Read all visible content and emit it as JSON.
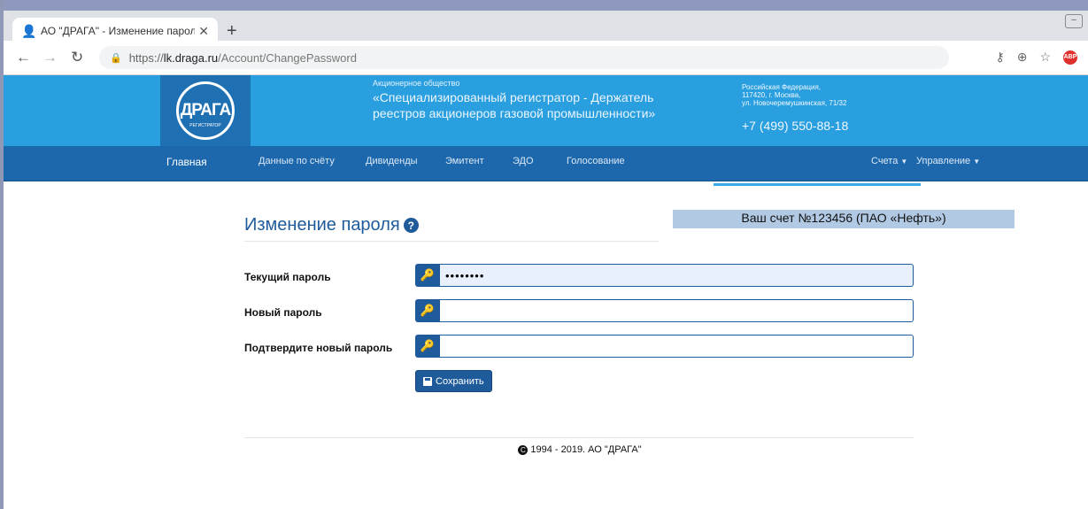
{
  "browser": {
    "tab_title": "АО \"ДРАГА\" - Изменение парол",
    "tab_close": "✕",
    "new_tab": "+",
    "url_scheme": "https://",
    "url_host": "lk.draga.ru",
    "url_path": "/Account/ChangePassword"
  },
  "header": {
    "logo_letters": "ДРАГА",
    "logo_sub": "РЕГИСТРАТОР",
    "company_small": "Акционерное общество",
    "company_name": "«Специализированный регистратор - Держатель реестров акционеров газовой промышленности»",
    "address_lines": [
      "Российская Федерация,",
      "117420, г. Москва,",
      "ул. Новочеремушкинская, 71/32"
    ],
    "phone": "+7 (499) 550-88-18"
  },
  "nav": {
    "items": [
      "Главная",
      "Данные по счёту",
      "Дивиденды",
      "Эмитент",
      "ЭДО",
      "Голосование"
    ],
    "right_items": [
      "Счета",
      "Управление"
    ]
  },
  "account_banner": "Ваш счет №123456 (ПАО «Нефть»)",
  "page_title": "Изменение пароля",
  "form": {
    "current_label": "Текущий пароль",
    "current_value": "••••••••",
    "new_label": "Новый пароль",
    "new_value": "",
    "confirm_label": "Подтвердите новый пароль",
    "confirm_value": "",
    "save_label": "Сохранить"
  },
  "footer": {
    "text": "1994 - 2019. АО \"ДРАГА\""
  },
  "colors": {
    "header_bg": "#2a9fe0",
    "navbar_bg": "#1d68ad",
    "primary": "#1f5b9b",
    "banner_bg": "#b2c9e4"
  }
}
